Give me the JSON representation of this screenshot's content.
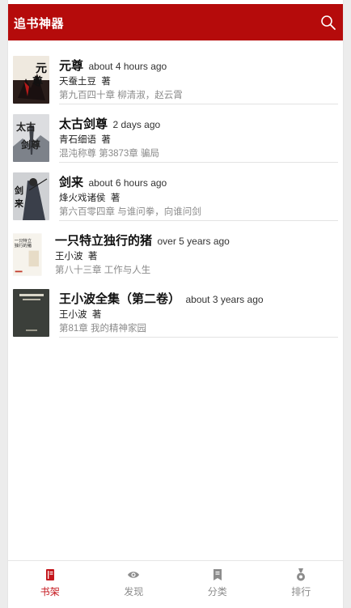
{
  "header": {
    "title": "追书神器",
    "color": "#b50b0b"
  },
  "books": [
    {
      "name": "元尊",
      "updated": "about 4 hours ago",
      "author": "天蚕土豆",
      "author_suffix": "著",
      "latest_chapter": "第九百四十章  柳清淑，赵云霄"
    },
    {
      "name": "太古剑尊",
      "updated": "2 days ago",
      "author": "青石细语",
      "author_suffix": "著",
      "latest_chapter": "混沌称尊  第3873章  骗局"
    },
    {
      "name": "剑来",
      "updated": "about 6 hours ago",
      "author": "烽火戏诸侯",
      "author_suffix": "著",
      "latest_chapter": "第六百零四章  与谁问拳，向谁问剑"
    },
    {
      "name": "一只特立独行的猪",
      "updated": "over 5 years ago",
      "author": "王小波",
      "author_suffix": "著",
      "latest_chapter": "第八十三章  工作与人生"
    },
    {
      "name": "王小波全集（第二卷）",
      "updated": "about 3 years ago",
      "author": "王小波",
      "author_suffix": "著",
      "latest_chapter": "第81章  我的精神家园"
    }
  ],
  "nav": {
    "items": [
      {
        "label": "书架",
        "icon": "book-icon",
        "active": true
      },
      {
        "label": "发现",
        "icon": "eye-icon",
        "active": false
      },
      {
        "label": "分类",
        "icon": "bookmark-icon",
        "active": false
      },
      {
        "label": "排行",
        "icon": "medal-icon",
        "active": false
      }
    ],
    "active_color": "#c4161c",
    "inactive_color": "#8c8c8c"
  }
}
